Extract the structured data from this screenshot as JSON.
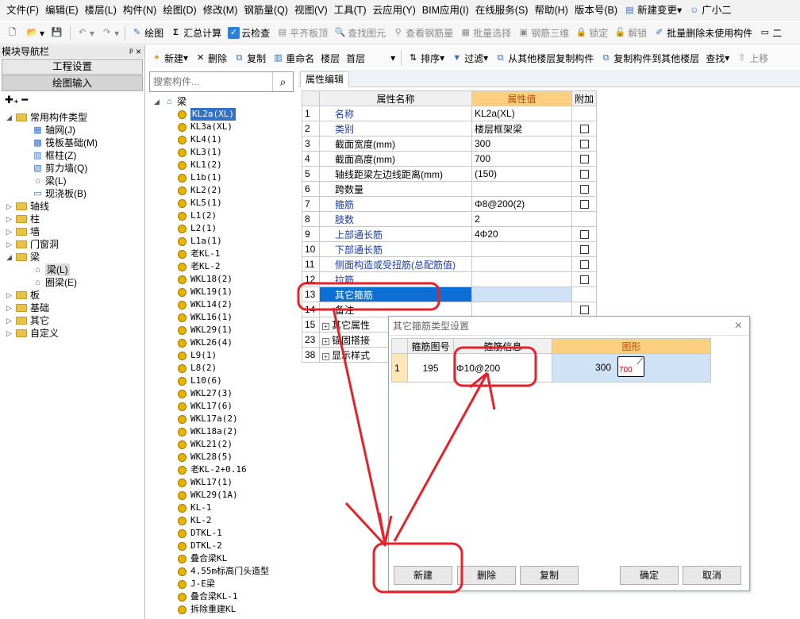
{
  "menu": [
    "文件(F)",
    "编辑(E)",
    "楼层(L)",
    "构件(N)",
    "绘图(D)",
    "修改(M)",
    "钢筋量(Q)",
    "视图(V)",
    "工具(T)",
    "云应用(Y)",
    "BIM应用(I)",
    "在线服务(S)",
    "帮助(H)",
    "版本号(B)",
    "新建变更",
    "广小二"
  ],
  "toolbar1": {
    "draw": "绘图",
    "sum": "汇总计算",
    "cloud_check": "云检查",
    "level_top": "平齐板顶",
    "find_elem": "查找图元",
    "view_rebar": "查看钢筋量",
    "batch_select": "批量选择",
    "rebar_3d": "钢筋三维",
    "lock": "锁定",
    "unlock": "解锁",
    "batch_delete": "批量删除未使用构件",
    "last": "二"
  },
  "leftnav": {
    "title": "模块导航栏",
    "pin": "ᵖ x",
    "btn_project": "工程设置",
    "btn_draw": "绘图输入",
    "tree": {
      "common": "常用构件类型",
      "common_items": [
        "轴网(J)",
        "筏板基础(M)",
        "框柱(Z)",
        "剪力墙(Q)",
        "梁(L)",
        "现浇板(B)"
      ],
      "axis": "轴线",
      "column": "柱",
      "wall": "墙",
      "door": "门窗洞",
      "beam": "梁",
      "beam_items": [
        "梁(L)",
        "圈梁(E)"
      ],
      "slab": "板",
      "found": "基础",
      "other": "其它",
      "custom": "自定义"
    }
  },
  "toolbar2": {
    "new": "新建",
    "delete": "删除",
    "copy": "复制",
    "rename": "重命名",
    "floor_label": "楼层",
    "floor_value": "首层",
    "sort": "排序",
    "filter": "过滤",
    "copy_from": "从其他楼层复制构件",
    "copy_to": "复制构件到其他楼层",
    "find": "查找",
    "up": "上移"
  },
  "search": {
    "placeholder": "搜索构件..."
  },
  "component_tree": {
    "root": "梁",
    "items": [
      "KL2a(XL)",
      "KL3a(XL)",
      "KL4(1)",
      "KL3(1)",
      "KL1(2)",
      "L1b(1)",
      "KL2(2)",
      "KL5(1)",
      "L1(2)",
      "L2(1)",
      "L1a(1)",
      "老KL-1",
      "老KL-2",
      "WKL18(2)",
      "WKL19(1)",
      "WKL14(2)",
      "WKL16(1)",
      "WKL29(1)",
      "WKL26(4)",
      "L9(1)",
      "L8(2)",
      "L10(6)",
      "WKL27(3)",
      "WKL17(6)",
      "WKL17a(2)",
      "WKL18a(2)",
      "WKL21(2)",
      "WKL28(5)",
      "老KL-2+0.16",
      "WKL17(1)",
      "WKL29(1A)",
      "KL-1",
      "KL-2",
      "DTKL-1",
      "DTKL-2",
      "叠合梁KL",
      "4.55m标高门头造型",
      "J-E梁",
      "叠合梁KL-1",
      "拆除重建KL"
    ],
    "selected": 0
  },
  "tab": {
    "label": "属性编辑"
  },
  "props": {
    "headers": [
      "属性名称",
      "属性值",
      "附加"
    ],
    "rows": [
      {
        "n": "1",
        "name": "名称",
        "value": "KL2a(XL)",
        "cb": false,
        "blue": true
      },
      {
        "n": "2",
        "name": "类别",
        "value": "楼层框架梁",
        "cb": true,
        "blue": true
      },
      {
        "n": "3",
        "name": "截面宽度(mm)",
        "value": "300",
        "cb": true,
        "blue": false
      },
      {
        "n": "4",
        "name": "截面高度(mm)",
        "value": "700",
        "cb": true,
        "blue": false
      },
      {
        "n": "5",
        "name": "轴线距梁左边线距离(mm)",
        "value": "(150)",
        "cb": true,
        "blue": false
      },
      {
        "n": "6",
        "name": "跨数量",
        "value": "",
        "cb": true,
        "blue": false
      },
      {
        "n": "7",
        "name": "箍筋",
        "value": "Φ8@200(2)",
        "cb": true,
        "blue": true
      },
      {
        "n": "8",
        "name": "肢数",
        "value": "2",
        "cb": false,
        "blue": true
      },
      {
        "n": "9",
        "name": "上部通长筋",
        "value": "4Φ20",
        "cb": true,
        "blue": true
      },
      {
        "n": "10",
        "name": "下部通长筋",
        "value": "",
        "cb": true,
        "blue": true
      },
      {
        "n": "11",
        "name": "侧面构造或受扭筋(总配筋值)",
        "value": "",
        "cb": true,
        "blue": true
      },
      {
        "n": "12",
        "name": "拉筋",
        "value": "",
        "cb": true,
        "blue": true
      },
      {
        "n": "13",
        "name": "其它箍筋",
        "value": "",
        "cb": false,
        "blue": false,
        "sel": true
      },
      {
        "n": "14",
        "name": "备注",
        "value": "",
        "cb": true,
        "blue": false
      },
      {
        "n": "15",
        "name": "其它属性",
        "value": "",
        "cb": false,
        "blue": false,
        "plus": true
      },
      {
        "n": "23",
        "name": "锚固搭接",
        "value": "",
        "cb": false,
        "blue": false,
        "plus": true
      },
      {
        "n": "38",
        "name": "显示样式",
        "value": "",
        "cb": false,
        "blue": false,
        "plus": true
      }
    ]
  },
  "dialog": {
    "title": "其它箍筋类型设置",
    "close": "×",
    "headers": [
      "",
      "箍筋图号",
      "箍筋信息",
      "图形"
    ],
    "row": {
      "n": "1",
      "code": "195",
      "info": "Φ10@200",
      "shape_left": "300",
      "shape_inner": "700"
    },
    "buttons": {
      "new": "新建",
      "delete": "删除",
      "copy": "复制",
      "ok": "确定",
      "cancel": "取消"
    }
  },
  "colors": {
    "annotation": "#e8202a",
    "selection": "#0d6ed6",
    "header_highlight": "#fcd080"
  }
}
